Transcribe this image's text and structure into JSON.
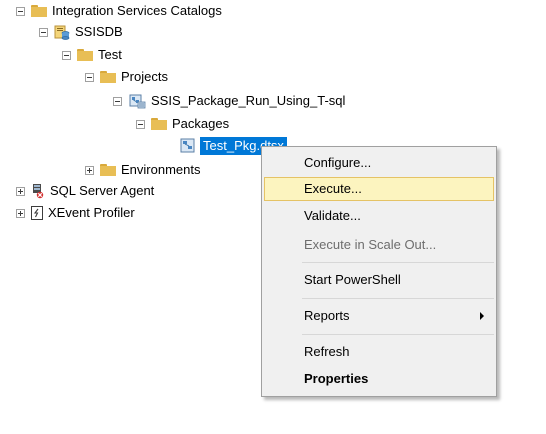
{
  "tree": {
    "integration_services_catalogs": "Integration Services Catalogs",
    "ssisdb": "SSISDB",
    "test": "Test",
    "projects": "Projects",
    "project_name": "SSIS_Package_Run_Using_T-sql",
    "packages": "Packages",
    "selected_package": "Test_Pkg.dtsx",
    "environments": "Environments",
    "sql_server_agent": "SQL Server Agent",
    "xevent_profiler": "XEvent Profiler"
  },
  "context_menu": {
    "configure": "Configure...",
    "execute": "Execute...",
    "validate": "Validate...",
    "execute_scale_out": "Execute in Scale Out...",
    "start_powershell": "Start PowerShell",
    "reports": "Reports",
    "refresh": "Refresh",
    "properties": "Properties"
  },
  "colors": {
    "selection": "#0078d7",
    "menu_highlight": "#fcf4bf",
    "menu_highlight_border": "#e5c365",
    "folder": "#e8be55"
  }
}
